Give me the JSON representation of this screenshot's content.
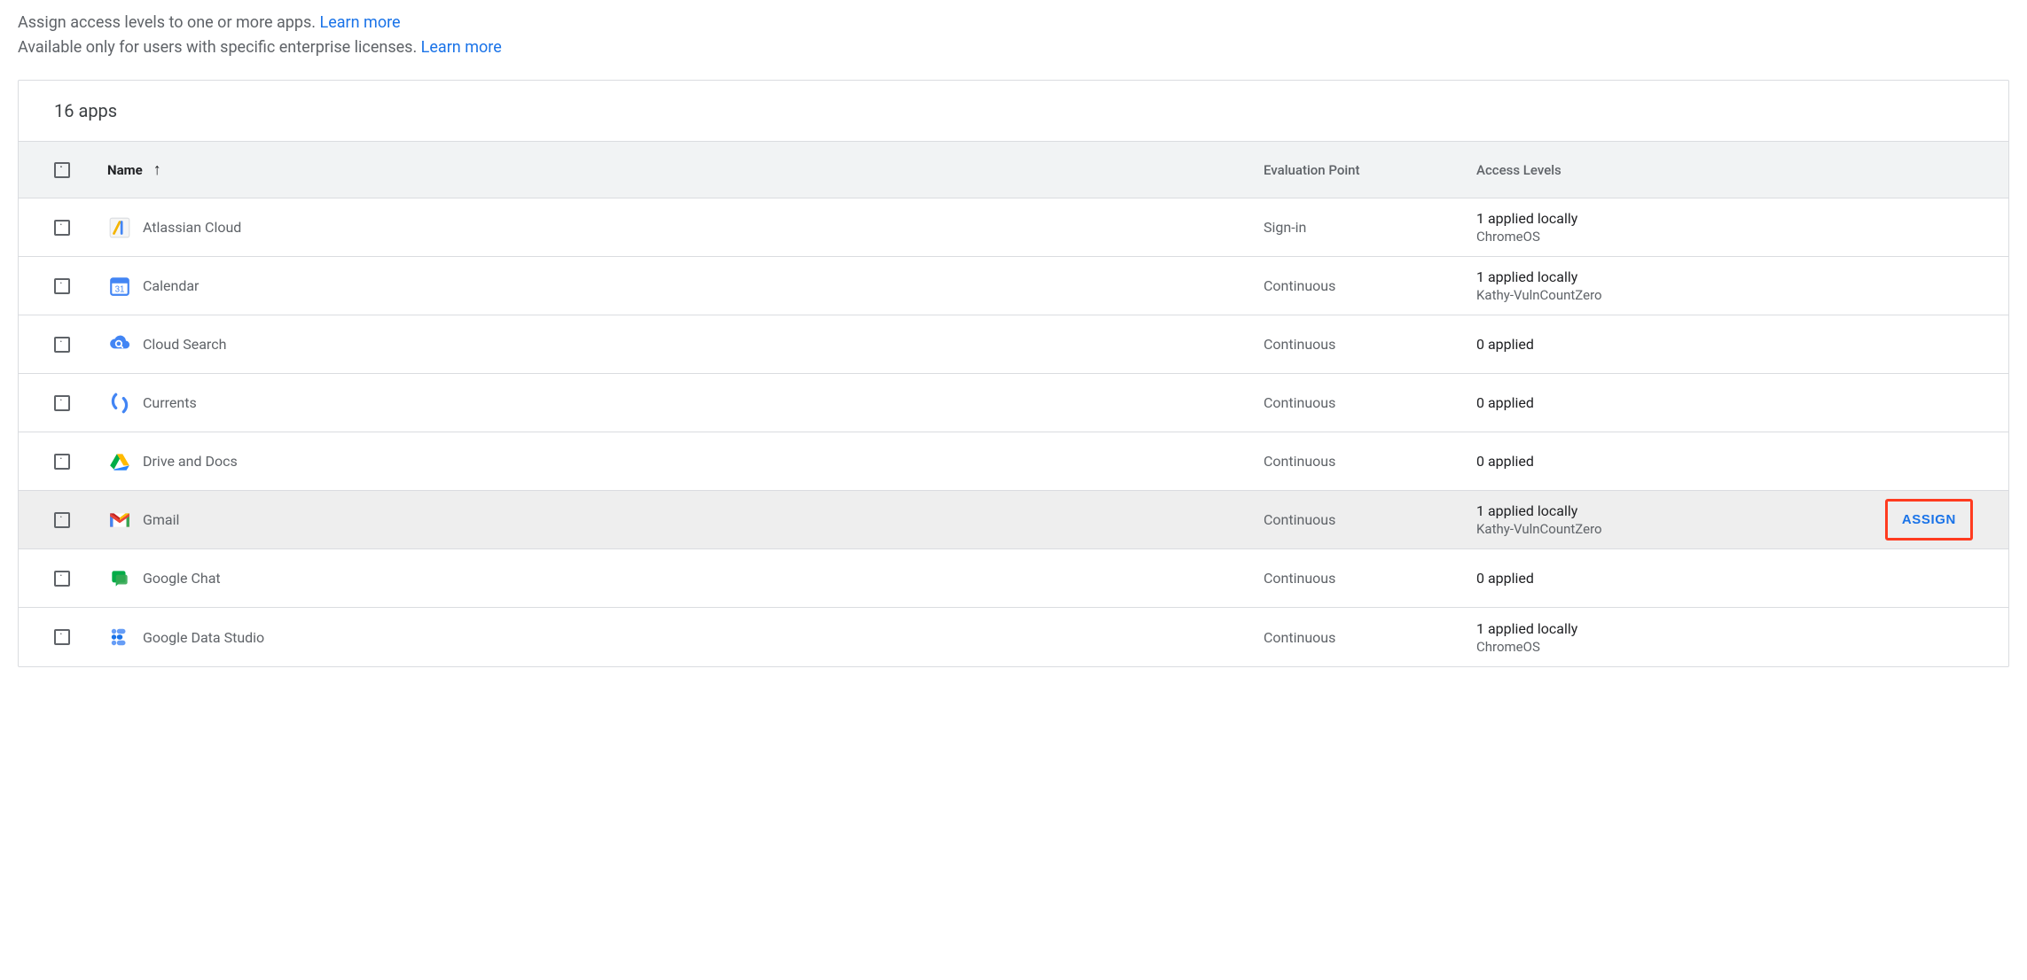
{
  "intro": {
    "line1_prefix": "Assign access levels to one or more apps. ",
    "line1_link": "Learn more",
    "line2_prefix": "Available only for users with specific enterprise licenses. ",
    "line2_link": "Learn more"
  },
  "card": {
    "title": "16 apps"
  },
  "columns": {
    "name": "Name",
    "sort_arrow": "↑",
    "eval": "Evaluation Point",
    "access": "Access Levels"
  },
  "assign_label": "ASSIGN",
  "rows": [
    {
      "icon": "atlassian",
      "name": "Atlassian Cloud",
      "eval": "Sign-in",
      "access_primary": "1 applied locally",
      "access_secondary": "ChromeOS",
      "hovered": false,
      "show_assign": false
    },
    {
      "icon": "calendar",
      "name": "Calendar",
      "eval": "Continuous",
      "access_primary": "1 applied locally",
      "access_secondary": "Kathy-VulnCountZero",
      "hovered": false,
      "show_assign": false
    },
    {
      "icon": "cloudsearch",
      "name": "Cloud Search",
      "eval": "Continuous",
      "access_primary": "0 applied",
      "access_secondary": "",
      "hovered": false,
      "show_assign": false
    },
    {
      "icon": "currents",
      "name": "Currents",
      "eval": "Continuous",
      "access_primary": "0 applied",
      "access_secondary": "",
      "hovered": false,
      "show_assign": false
    },
    {
      "icon": "drive",
      "name": "Drive and Docs",
      "eval": "Continuous",
      "access_primary": "0 applied",
      "access_secondary": "",
      "hovered": false,
      "show_assign": false
    },
    {
      "icon": "gmail",
      "name": "Gmail",
      "eval": "Continuous",
      "access_primary": "1 applied locally",
      "access_secondary": "Kathy-VulnCountZero",
      "hovered": true,
      "show_assign": true
    },
    {
      "icon": "chat",
      "name": "Google Chat",
      "eval": "Continuous",
      "access_primary": "0 applied",
      "access_secondary": "",
      "hovered": false,
      "show_assign": false
    },
    {
      "icon": "datastudio",
      "name": "Google Data Studio",
      "eval": "Continuous",
      "access_primary": "1 applied locally",
      "access_secondary": "ChromeOS",
      "hovered": false,
      "show_assign": false
    }
  ]
}
